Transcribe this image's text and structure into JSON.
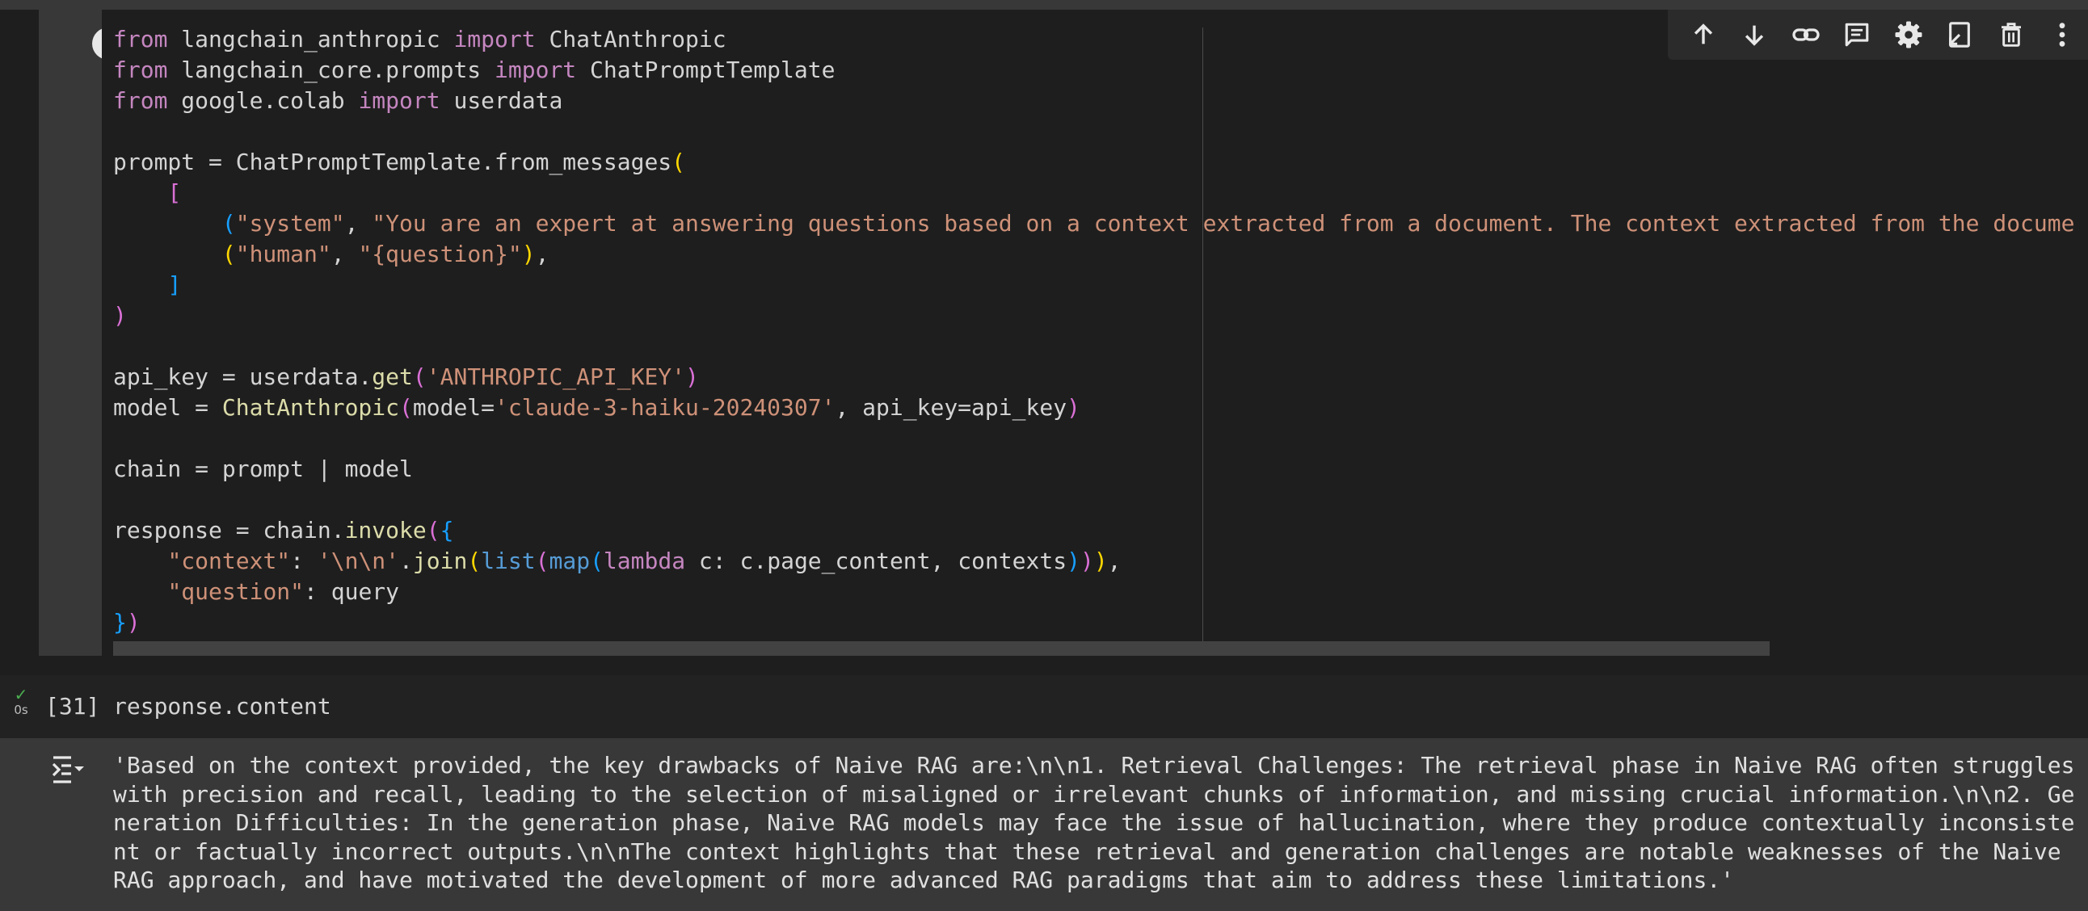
{
  "cell1": {
    "lines": [
      "from langchain_anthropic import ChatAnthropic",
      "from langchain_core.prompts import ChatPromptTemplate",
      "from google.colab import userdata",
      "",
      "prompt = ChatPromptTemplate.from_messages(",
      "    [",
      "        (\"system\", \"You are an expert at answering questions based on a context extracted from a document. The context extracted from the docume",
      "        (\"human\", \"{question}\"),",
      "    ]",
      ")",
      "",
      "api_key = userdata.get('ANTHROPIC_API_KEY')",
      "model = ChatAnthropic(model='claude-3-haiku-20240307', api_key=api_key)",
      "",
      "chain = prompt | model",
      "",
      "response = chain.invoke({",
      "    \"context\": '\\n\\n'.join(list(map(lambda c: c.page_content, contexts))),",
      "    \"question\": query",
      "})"
    ]
  },
  "toolbar": {
    "icons": [
      "arrow-up-icon",
      "arrow-down-icon",
      "link-icon",
      "comment-icon",
      "gear-icon",
      "mirror-cell-icon",
      "trash-icon",
      "more-vert-icon"
    ]
  },
  "cell2": {
    "status_check": "✓",
    "exec_time": "0s",
    "exec_count": "[31]",
    "code": "response.content"
  },
  "output": {
    "text": "'Based on the context provided, the key drawbacks of Naive RAG are:\\n\\n1. Retrieval Challenges: The retrieval phase in Naive RAG often struggles with precision and recall, leading to the selection of misaligned or irrelevant chunks of information, and missing crucial information.\\n\\n2. Generation Difficulties: In the generation phase, Naive RAG models may face the issue of hallucination, where they produce contextually inconsistent or factually incorrect outputs.\\n\\nThe context highlights that these retrieval and generation challenges are notable weaknesses of the Naive RAG approach, and have motivated the development of more advanced RAG paradigms that aim to address these limitations.'"
  },
  "colors": {
    "background": "#1e1e1e",
    "gutter": "#383838",
    "keyword": "#c586c0",
    "string": "#ce9178",
    "function": "#dcdcaa",
    "builtin": "#569cd6",
    "bracket1": "#ffd700",
    "bracket2": "#da70d6",
    "bracket3": "#179fff",
    "success": "#4caf50"
  }
}
